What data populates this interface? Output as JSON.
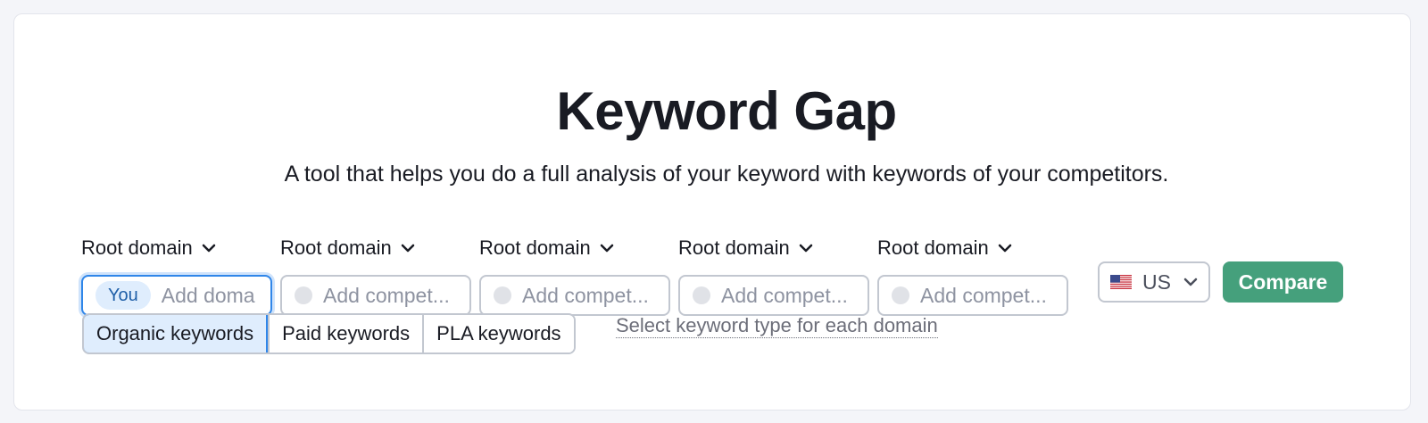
{
  "page": {
    "title": "Keyword Gap",
    "subtitle": "A tool that helps you do a full analysis of your keyword with keywords of your competitors."
  },
  "domains": [
    {
      "type_label": "Root domain",
      "you_label": "You",
      "placeholder": "Add doma"
    },
    {
      "type_label": "Root domain",
      "placeholder": "Add compet..."
    },
    {
      "type_label": "Root domain",
      "placeholder": "Add compet..."
    },
    {
      "type_label": "Root domain",
      "placeholder": "Add compet..."
    },
    {
      "type_label": "Root domain",
      "placeholder": "Add compet..."
    }
  ],
  "database": {
    "value": "US",
    "flag_icon": "us-flag-icon"
  },
  "compare_button": {
    "label": "Compare",
    "color": "#45a07c"
  },
  "keyword_types": {
    "options": [
      "Organic keywords",
      "Paid keywords",
      "PLA keywords"
    ],
    "selected": "Organic keywords",
    "per_domain_link": "Select keyword type for each domain"
  },
  "colors": {
    "accent_blue": "#2f86e9",
    "selected_bg": "#dfedfd",
    "text_dark": "#191b23",
    "placeholder": "#8e93a1"
  }
}
